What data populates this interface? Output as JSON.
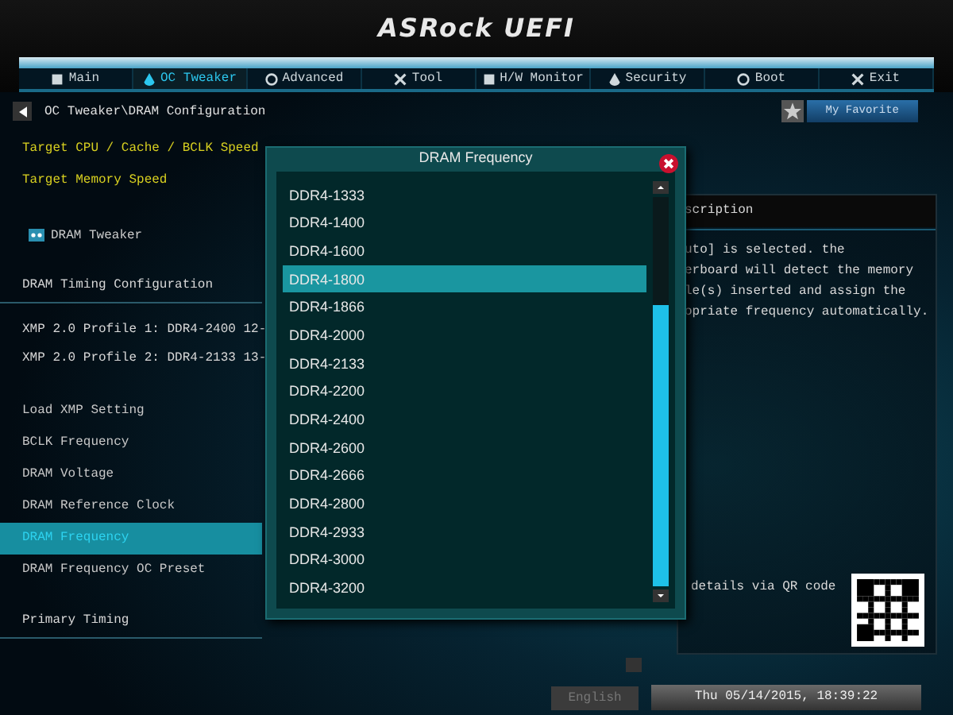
{
  "logo": "ASRock UEFI",
  "tabs": [
    {
      "label": "Main",
      "selected": false
    },
    {
      "label": "OC Tweaker",
      "selected": true
    },
    {
      "label": "Advanced",
      "selected": false
    },
    {
      "label": "Tool",
      "selected": false
    },
    {
      "label": "H/W Monitor",
      "selected": false
    },
    {
      "label": "Security",
      "selected": false
    },
    {
      "label": "Boot",
      "selected": false
    },
    {
      "label": "Exit",
      "selected": false
    }
  ],
  "breadcrumb": "OC Tweaker\\DRAM Configuration",
  "favorite_button": "My Favorite",
  "settings": [
    {
      "kind": "highlight",
      "label": "Target CPU / Cache / BCLK Speed"
    },
    {
      "kind": "highlight",
      "label": "Target Memory Speed"
    },
    {
      "kind": "submenu",
      "label": "DRAM Tweaker"
    },
    {
      "kind": "section",
      "label": "DRAM Timing Configuration"
    },
    {
      "kind": "info",
      "label": "XMP 2.0 Profile 1: DDR4-2400 12-"
    },
    {
      "kind": "info",
      "label": "XMP 2.0 Profile 2: DDR4-2133 13-"
    },
    {
      "kind": "item",
      "label": "Load XMP Setting",
      "selected": false
    },
    {
      "kind": "item",
      "label": "BCLK Frequency",
      "selected": false
    },
    {
      "kind": "item",
      "label": "DRAM Voltage",
      "selected": false
    },
    {
      "kind": "item",
      "label": "DRAM Reference Clock",
      "selected": false
    },
    {
      "kind": "item",
      "label": "DRAM Frequency",
      "selected": true
    },
    {
      "kind": "item",
      "label": "DRAM Frequency OC Preset",
      "selected": false
    },
    {
      "kind": "section",
      "label": "Primary Timing"
    }
  ],
  "description": {
    "title": "scription",
    "lines": [
      "uto] is selected. the",
      "erboard will detect the memory",
      "le(s) inserted and assign the",
      "opriate frequency automatically."
    ],
    "qr_caption": "details via QR code"
  },
  "dialog": {
    "title": "DRAM Frequency",
    "options": [
      {
        "label": "DDR4-1333",
        "selected": false
      },
      {
        "label": "DDR4-1400",
        "selected": false
      },
      {
        "label": "DDR4-1600",
        "selected": false
      },
      {
        "label": "DDR4-1800",
        "selected": true
      },
      {
        "label": "DDR4-1866",
        "selected": false
      },
      {
        "label": "DDR4-2000",
        "selected": false
      },
      {
        "label": "DDR4-2133",
        "selected": false
      },
      {
        "label": "DDR4-2200",
        "selected": false
      },
      {
        "label": "DDR4-2400",
        "selected": false
      },
      {
        "label": "DDR4-2600",
        "selected": false
      },
      {
        "label": "DDR4-2666",
        "selected": false
      },
      {
        "label": "DDR4-2800",
        "selected": false
      },
      {
        "label": "DDR4-2933",
        "selected": false
      },
      {
        "label": "DDR4-3000",
        "selected": false
      },
      {
        "label": "DDR4-3200",
        "selected": false
      }
    ]
  },
  "language_button": "English",
  "datetime": "Thu 05/14/2015, 18:39:22"
}
